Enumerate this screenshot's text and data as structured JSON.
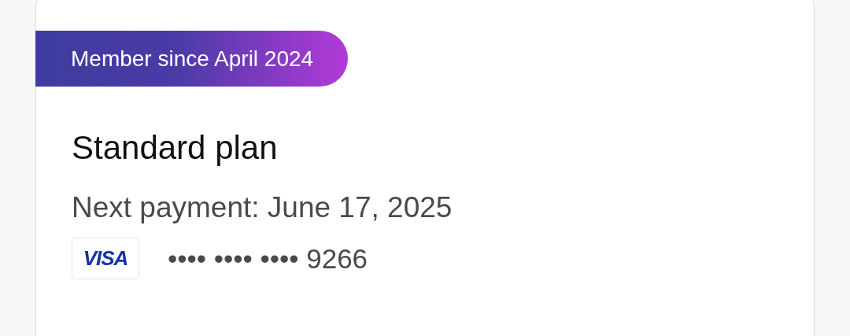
{
  "badge": {
    "text": "Member since April 2024"
  },
  "plan": {
    "name": "Standard plan",
    "next_payment": "Next payment: June 17, 2025"
  },
  "payment_card": {
    "brand": "VISA",
    "masked_number": "•••• •••• •••• 9266"
  }
}
